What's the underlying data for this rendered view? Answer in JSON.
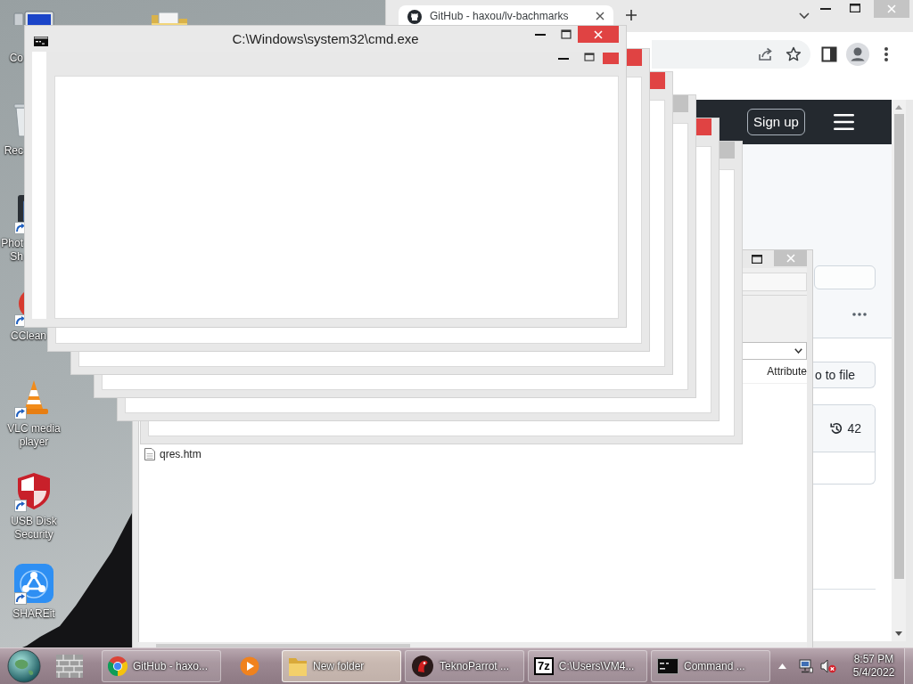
{
  "desktop": {
    "icons": [
      {
        "kind": "computer",
        "label": "Co",
        "shortcut": false
      },
      {
        "kind": "bin",
        "label": "Rec",
        "shortcut": false
      },
      {
        "kind": "photo",
        "label": "Phot Sh",
        "shortcut": true
      },
      {
        "kind": "cleaner",
        "label": "CClean",
        "shortcut": true
      },
      {
        "kind": "cone",
        "label": "VLC media player",
        "shortcut": true
      },
      {
        "kind": "shield",
        "label": "USB Disk Security",
        "shortcut": true
      },
      {
        "kind": "share",
        "label": "SHAREit",
        "shortcut": true
      }
    ],
    "second_column": [
      {
        "kind": "folder"
      }
    ]
  },
  "browser": {
    "tabs": [
      {
        "title": "GitHub - haxou/lv-bachmarks",
        "selected": true
      }
    ],
    "page": {
      "sign_up": "Sign up",
      "go_to_file": "o to file",
      "history_count": "42"
    }
  },
  "explorer": {
    "columns": [
      {
        "label": "Attribute"
      }
    ],
    "files": [
      {
        "name": "qres.htm"
      }
    ]
  },
  "console": {
    "title": "C:\\Windows\\system32\\cmd.exe",
    "ghost_bar": {
      "active": true
    },
    "ghost_frames": [
      {
        "active": true
      },
      {
        "active": true
      },
      {
        "active": false
      },
      {
        "active": true
      },
      {
        "active": false
      }
    ]
  },
  "taskbar": {
    "buttons": [
      {
        "kind": "firewall",
        "selected": false
      },
      {
        "kind": "chrome",
        "label": "GitHub - haxo...",
        "selected": false
      },
      {
        "kind": "media",
        "selected": false
      },
      {
        "kind": "folder",
        "label": "New folder",
        "selected": true
      },
      {
        "kind": "parrot",
        "label": "TeknoParrot ...",
        "selected": false
      },
      {
        "kind": "archive",
        "icon_text": "7z",
        "label": "C:\\Users\\VM4...",
        "selected": false
      },
      {
        "kind": "cmd",
        "label": "Command ...",
        "selected": false
      }
    ],
    "tray": {
      "muted": true,
      "time": "8:57 PM",
      "date": "5/4/2022"
    }
  }
}
